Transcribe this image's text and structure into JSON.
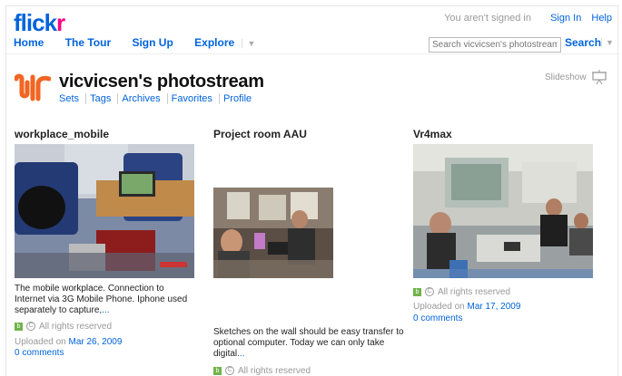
{
  "header": {
    "logo_main": "flick",
    "logo_accent": "r",
    "signed_status": "You aren't signed in",
    "sign_in": "Sign In",
    "help": "Help",
    "nav": [
      "Home",
      "The Tour",
      "Sign Up",
      "Explore"
    ],
    "search_placeholder": "Search vicvicsen's photostream",
    "search_button": "Search"
  },
  "photostream": {
    "title": "vicvicsen's photostream",
    "subnav": [
      "Sets",
      "Tags",
      "Archives",
      "Favorites",
      "Profile"
    ],
    "slideshow": "Slideshow"
  },
  "photos": [
    {
      "title": "workplace_mobile",
      "caption": "The mobile workplace. Connection to Internet via 3G Mobile Phone. Iphone used separately to capture,",
      "more": "...",
      "rights": "All rights reserved",
      "uploaded_prefix": "Uploaded on",
      "uploaded_date": "Mar 26, 2009",
      "comments": "0 comments"
    },
    {
      "title": "Project room AAU",
      "caption": "Sketches on the wall should be easy transfer to optional computer. Today we can only take digital",
      "more": "...",
      "rights": "All rights reserved"
    },
    {
      "title": "Vr4max",
      "rights": "All rights reserved",
      "uploaded_prefix": "Uploaded on",
      "uploaded_date": "Mar 17, 2009",
      "comments": "0 comments"
    }
  ],
  "icons": {
    "cc_badge": "cc-icon",
    "copyright": "copyright-icon",
    "copyright_glyph": "C",
    "cc_glyph": "b"
  },
  "colors": {
    "link": "#0063dc",
    "logo_pink": "#ff0084",
    "buddy_orange": "#f26522"
  }
}
